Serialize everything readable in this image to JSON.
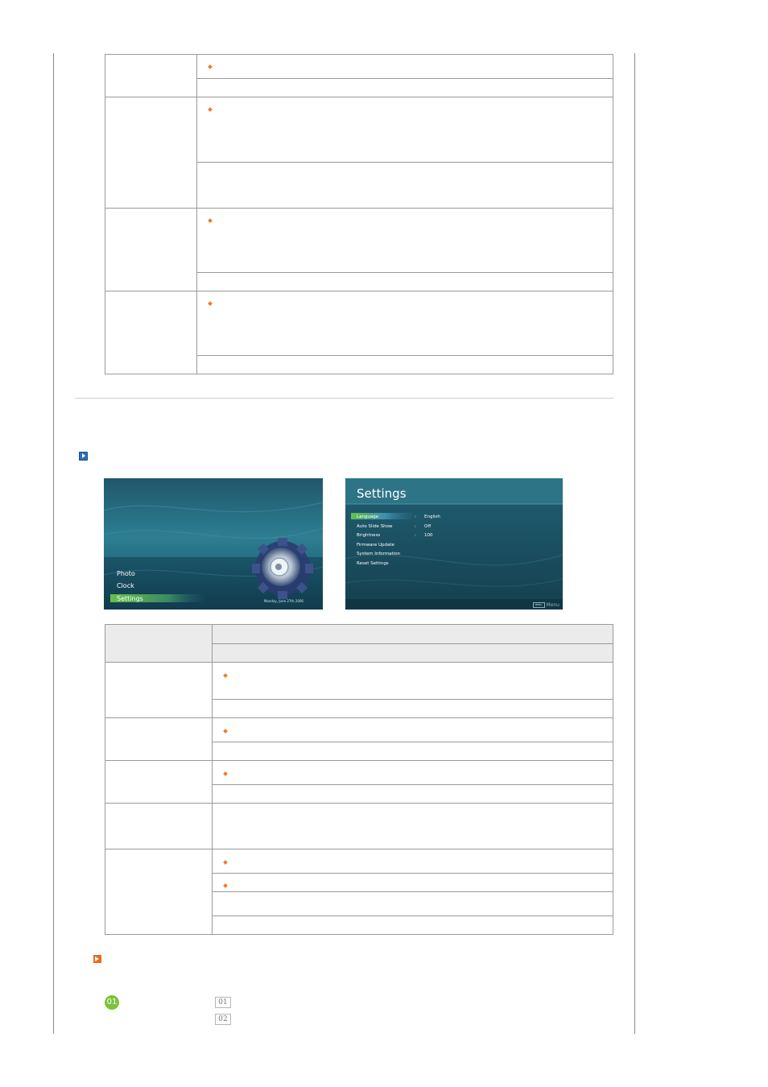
{
  "menu_screen": {
    "items": [
      "Photo",
      "Clock",
      "Settings"
    ],
    "selected": "Settings",
    "date": "Monday, June 27th 2006"
  },
  "settings_screen": {
    "title": "Settings",
    "rows": [
      {
        "label": "Language",
        "value": "English"
      },
      {
        "label": "Auto Slide Show",
        "value": "Off"
      },
      {
        "label": "Brightness",
        "value": "100"
      },
      {
        "label": "Firmware Update",
        "value": ""
      },
      {
        "label": "System Information",
        "value": ""
      },
      {
        "label": "Reset Settings",
        "value": ""
      }
    ],
    "separator": ":",
    "footer_button": "MENU",
    "footer_label": "Menu"
  },
  "steps": {
    "circle": "01",
    "boxes": [
      "01",
      "02"
    ]
  },
  "colors": {
    "bullet": "#f07a1e",
    "accent_green": "#7cc33a",
    "selection_green": "#5cc04a",
    "screen_bg": "#1d5a6e"
  }
}
